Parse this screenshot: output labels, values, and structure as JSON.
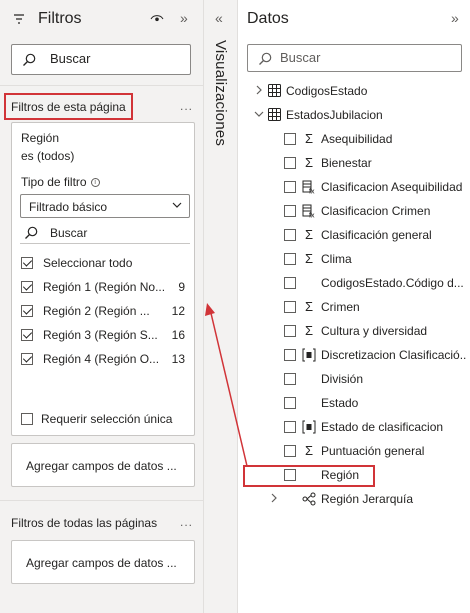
{
  "filters_pane": {
    "title": "Filtros",
    "collapse_glyph": "»",
    "search_placeholder": "Buscar",
    "this_page": {
      "label": "Filtros de esta página",
      "more": "...",
      "card": {
        "field": "Región",
        "state": "es (todos)",
        "filter_type_label": "Tipo de filtro",
        "filter_type_value": "Filtrado básico",
        "search_label": "Buscar",
        "items": [
          {
            "label": "Seleccionar todo",
            "count": "",
            "checked": true
          },
          {
            "label": "Región 1 (Región No...",
            "count": "9",
            "checked": true
          },
          {
            "label": "Región 2 (Región ...",
            "count": "12",
            "checked": true
          },
          {
            "label": "Región 3 (Región S...",
            "count": "16",
            "checked": true
          },
          {
            "label": "Región 4 (Región O...",
            "count": "13",
            "checked": true
          }
        ],
        "require_single": "Requerir selección única"
      },
      "add_fields": "Agregar campos de datos ..."
    },
    "all_pages": {
      "label": "Filtros de todas las páginas",
      "more": "...",
      "add_fields": "Agregar campos de datos ..."
    }
  },
  "viz_pane": {
    "label": "Visualizaciones",
    "expand_glyph": "«"
  },
  "data_pane": {
    "title": "Datos",
    "collapse_glyph": "»",
    "search_placeholder": "Buscar",
    "tables": [
      {
        "name": "CodigosEstado",
        "expanded": false
      },
      {
        "name": "EstadosJubilacion",
        "expanded": true
      }
    ],
    "fields": [
      {
        "name": "Asequibilidad",
        "icon": "sigma-icon"
      },
      {
        "name": "Bienestar",
        "icon": "sigma-icon"
      },
      {
        "name": "Clasificacion Asequibilidad",
        "icon": "calc-column-icon"
      },
      {
        "name": "Clasificacion Crimen",
        "icon": "calc-column-icon"
      },
      {
        "name": "Clasificación general",
        "icon": "sigma-icon"
      },
      {
        "name": "Clima",
        "icon": "sigma-icon"
      },
      {
        "name": "CodigosEstado.Código d...",
        "icon": ""
      },
      {
        "name": "Crimen",
        "icon": "sigma-icon"
      },
      {
        "name": "Cultura y diversidad",
        "icon": "sigma-icon"
      },
      {
        "name": "Discretizacion Clasificació...",
        "icon": "bin-icon"
      },
      {
        "name": "División",
        "icon": ""
      },
      {
        "name": "Estado",
        "icon": ""
      },
      {
        "name": "Estado de clasificacion",
        "icon": "bin-icon"
      },
      {
        "name": "Puntuación general",
        "icon": "sigma-icon"
      },
      {
        "name": "Región",
        "icon": ""
      }
    ],
    "hierarchy": {
      "name": "Región Jerarquía",
      "icon": "hierarchy-icon"
    }
  },
  "colors": {
    "highlight": "#d13438",
    "pane_bg": "#f3f2f1",
    "text": "#252423"
  }
}
